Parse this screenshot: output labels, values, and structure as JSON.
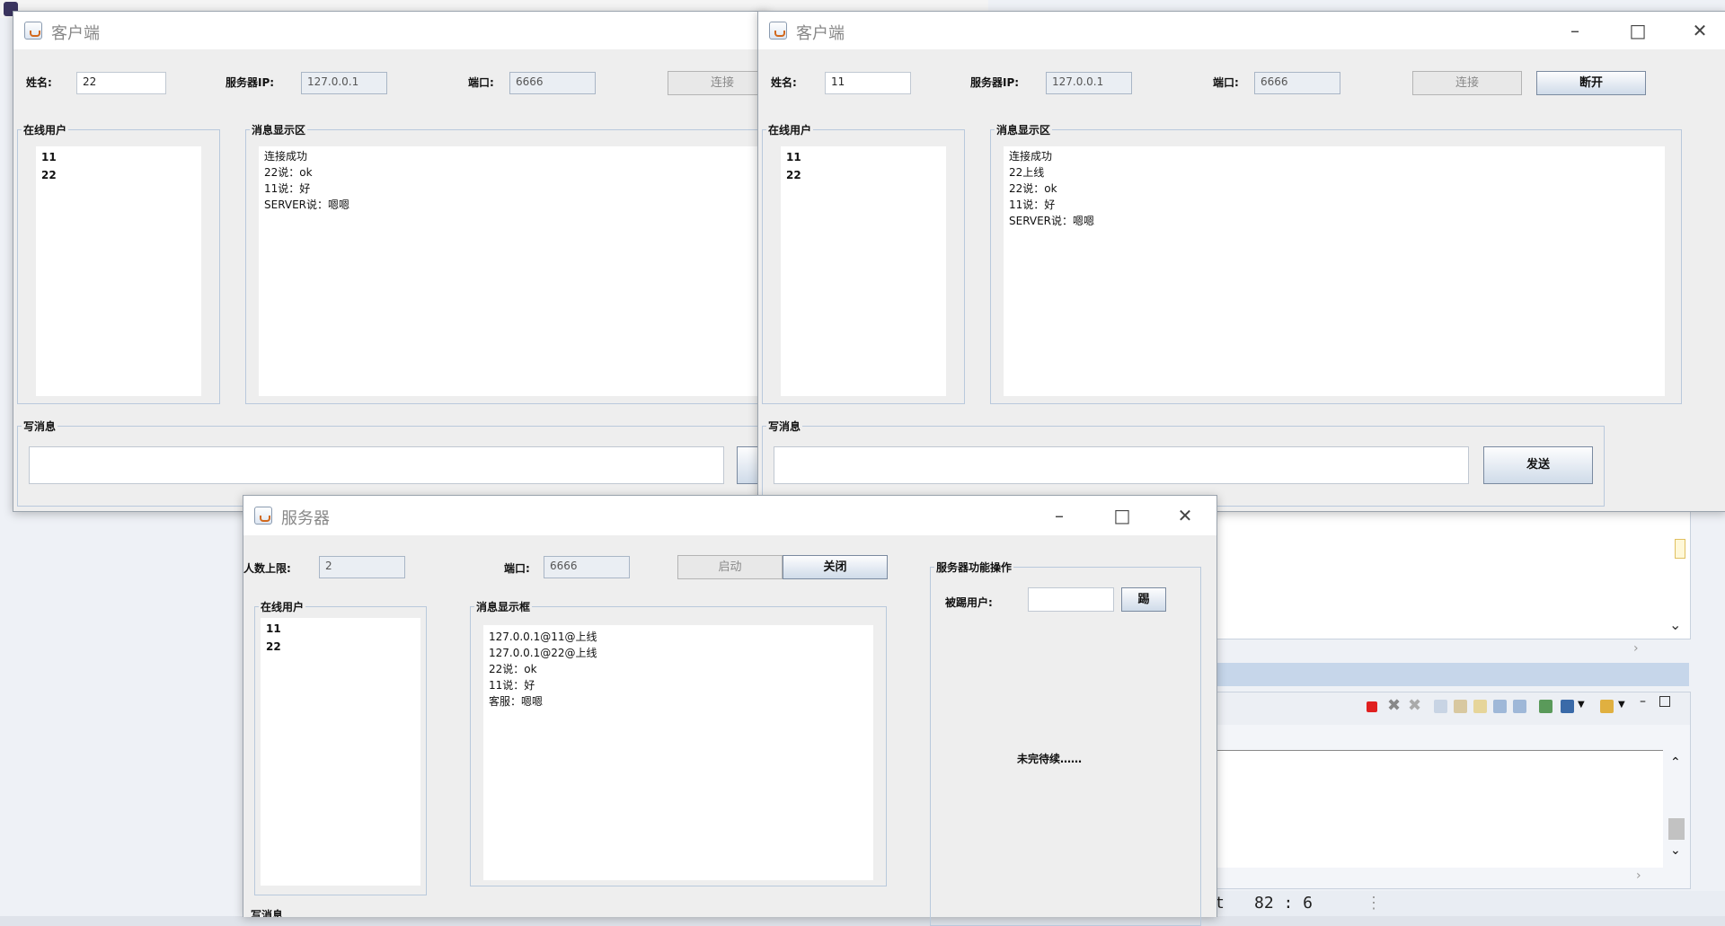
{
  "ide": {
    "status_position": "82 : 6",
    "status_prefix": "t"
  },
  "client_left": {
    "title": "客户端",
    "name_label": "姓名:",
    "name_value": "22",
    "server_ip_label": "服务器IP:",
    "server_ip_value": "127.0.0.1",
    "port_label": "端口:",
    "port_value": "6666",
    "connect_label": "连接",
    "online_title": "在线用户",
    "online_users": [
      "11",
      "22"
    ],
    "msg_title": "消息显示区",
    "messages": [
      "连接成功",
      "22说：ok",
      "11说：好",
      "SERVER说：嗯嗯"
    ],
    "write_title": "写消息"
  },
  "client_right": {
    "title": "客户端",
    "name_label": "姓名:",
    "name_value": "11",
    "server_ip_label": "服务器IP:",
    "server_ip_value": "127.0.0.1",
    "port_label": "端口:",
    "port_value": "6666",
    "connect_label": "连接",
    "disconnect_label": "断开",
    "online_title": "在线用户",
    "online_users": [
      "11",
      "22"
    ],
    "msg_title": "消息显示区",
    "messages": [
      "连接成功",
      "22上线",
      "22说：ok",
      "11说：好",
      "SERVER说：嗯嗯"
    ],
    "write_title": "写消息",
    "send_label": "发送"
  },
  "server": {
    "title": "服务器",
    "limit_label": "人数上限:",
    "limit_value": "2",
    "port_label": "端口:",
    "port_value": "6666",
    "start_label": "启动",
    "stop_label": "关闭",
    "online_title": "在线用户",
    "online_users": [
      "11",
      "22"
    ],
    "msg_title": "消息显示框",
    "messages": [
      "127.0.0.1@11@上线",
      "127.0.0.1@22@上线",
      "22说：ok",
      "11说：好",
      "客服：嗯嗯"
    ],
    "ops_title": "服务器功能操作",
    "kick_label": "被踢用户:",
    "kick_value": "",
    "kick_button": "踢",
    "pending_text": "未完待续……",
    "bottom_cut_label": "写消息"
  },
  "icons": [
    "java-icon",
    "minimize-icon",
    "maximize-icon",
    "close-icon"
  ],
  "colors": {
    "button_gradient_bottom": "#cfdbe9",
    "group_border": "#b9c9dc",
    "window_bg": "#eeeeee"
  }
}
